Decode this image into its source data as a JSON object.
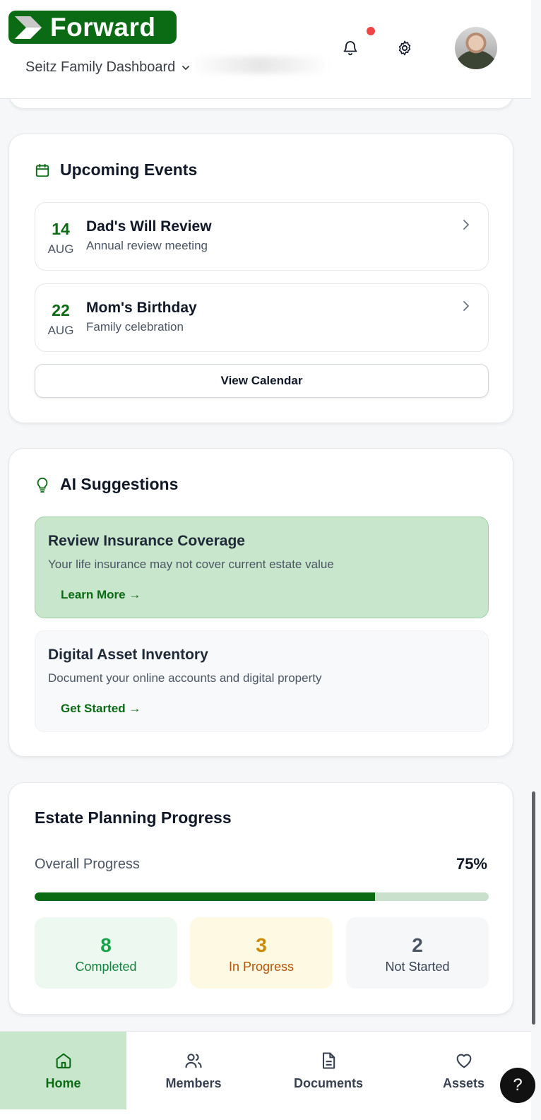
{
  "header": {
    "logo_text": "Forward",
    "family_selector": "Seitz Family Dashboard",
    "notification_dot": true
  },
  "events": {
    "title": "Upcoming Events",
    "items": [
      {
        "day": "14",
        "month": "AUG",
        "title": "Dad's Will Review",
        "subtitle": "Annual review meeting"
      },
      {
        "day": "22",
        "month": "AUG",
        "title": "Mom's Birthday",
        "subtitle": "Family celebration"
      }
    ],
    "view_calendar_label": "View Calendar"
  },
  "ai": {
    "title": "AI Suggestions",
    "items": [
      {
        "title": "Review Insurance Coverage",
        "description": "Your life insurance may not cover current estate value",
        "action": "Learn More →"
      },
      {
        "title": "Digital Asset Inventory",
        "description": "Document your online accounts and digital property",
        "action": "Get Started →"
      }
    ]
  },
  "progress": {
    "title": "Estate Planning Progress",
    "overall_label": "Overall Progress",
    "overall_value": "75%",
    "overall_fraction": 0.75,
    "stats": [
      {
        "value": "8",
        "label": "Completed"
      },
      {
        "value": "3",
        "label": "In Progress"
      },
      {
        "value": "2",
        "label": "Not Started"
      }
    ]
  },
  "nav": {
    "home": "Home",
    "members": "Members",
    "documents": "Documents",
    "assets": "Assets"
  },
  "help": {
    "label": "?"
  },
  "colors": {
    "brand_green": "#0b6b14",
    "highlight_green": "#c8e6cc",
    "notification_red": "#ef4444"
  }
}
